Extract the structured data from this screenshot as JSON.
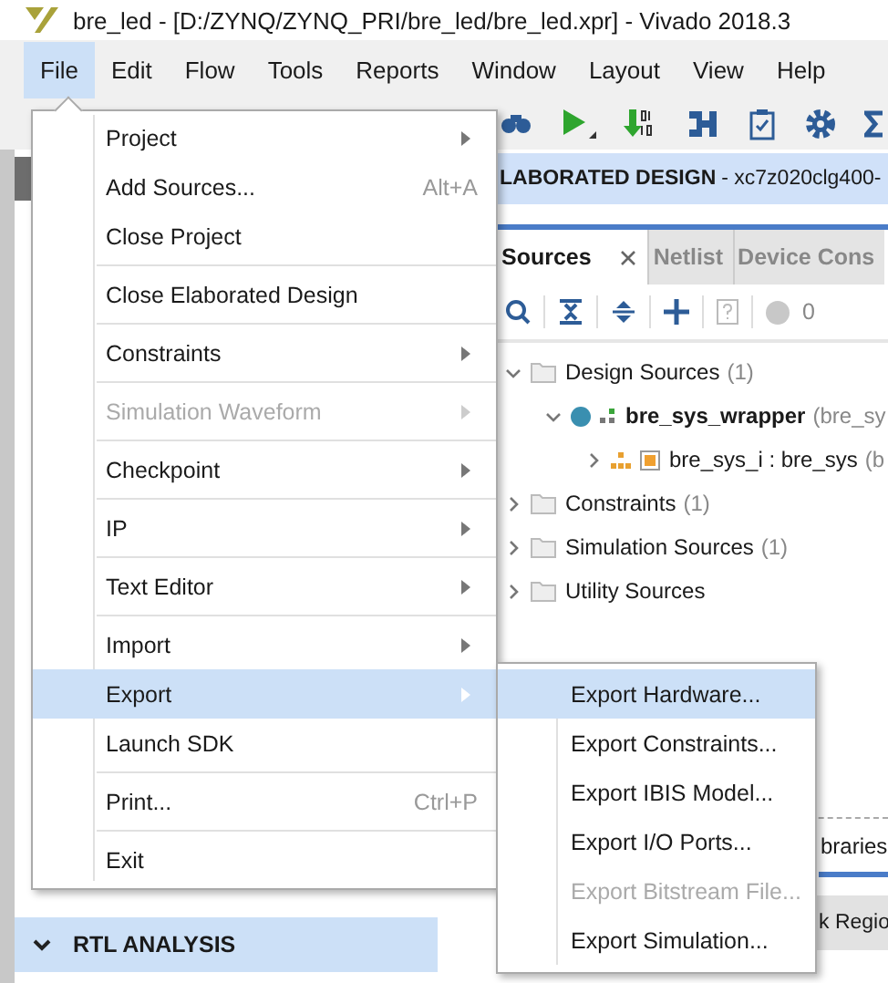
{
  "window": {
    "title": "bre_led - [D:/ZYNQ/ZYNQ_PRI/bre_led/bre_led.xpr] - Vivado 2018.3"
  },
  "menubar": [
    {
      "label": "File",
      "selected": true
    },
    {
      "label": "Edit",
      "selected": false
    },
    {
      "label": "Flow",
      "selected": false
    },
    {
      "label": "Tools",
      "selected": false
    },
    {
      "label": "Reports",
      "selected": false
    },
    {
      "label": "Window",
      "selected": false
    },
    {
      "label": "Layout",
      "selected": false
    },
    {
      "label": "View",
      "selected": false
    },
    {
      "label": "Help",
      "selected": false
    }
  ],
  "file_menu": [
    {
      "kind": "item",
      "label": "Project",
      "submenu": true,
      "disabled": false,
      "selected": false
    },
    {
      "kind": "item",
      "label": "Add Sources...",
      "shortcut": "Alt+A",
      "submenu": false,
      "disabled": false,
      "selected": false
    },
    {
      "kind": "item",
      "label": "Close Project",
      "submenu": false,
      "disabled": false,
      "selected": false
    },
    {
      "kind": "separator"
    },
    {
      "kind": "item",
      "label": "Close Elaborated Design",
      "submenu": false,
      "disabled": false,
      "selected": false
    },
    {
      "kind": "separator"
    },
    {
      "kind": "item",
      "label": "Constraints",
      "submenu": true,
      "disabled": false,
      "selected": false
    },
    {
      "kind": "separator"
    },
    {
      "kind": "item",
      "label": "Simulation Waveform",
      "submenu": true,
      "disabled": true,
      "selected": false
    },
    {
      "kind": "separator"
    },
    {
      "kind": "item",
      "label": "Checkpoint",
      "submenu": true,
      "disabled": false,
      "selected": false
    },
    {
      "kind": "separator"
    },
    {
      "kind": "item",
      "label": "IP",
      "submenu": true,
      "disabled": false,
      "selected": false
    },
    {
      "kind": "separator"
    },
    {
      "kind": "item",
      "label": "Text Editor",
      "submenu": true,
      "disabled": false,
      "selected": false
    },
    {
      "kind": "separator"
    },
    {
      "kind": "item",
      "label": "Import",
      "submenu": true,
      "disabled": false,
      "selected": false
    },
    {
      "kind": "item",
      "label": "Export",
      "submenu": true,
      "disabled": false,
      "selected": true
    },
    {
      "kind": "item",
      "label": "Launch SDK",
      "submenu": false,
      "disabled": false,
      "selected": false
    },
    {
      "kind": "separator"
    },
    {
      "kind": "item",
      "label": "Print...",
      "shortcut": "Ctrl+P",
      "submenu": false,
      "disabled": false,
      "selected": false
    },
    {
      "kind": "separator"
    },
    {
      "kind": "item",
      "label": "Exit",
      "submenu": false,
      "disabled": false,
      "selected": false
    }
  ],
  "export_submenu": [
    {
      "label": "Export Hardware...",
      "disabled": false,
      "selected": true
    },
    {
      "label": "Export Constraints...",
      "disabled": false,
      "selected": false
    },
    {
      "label": "Export IBIS Model...",
      "disabled": false,
      "selected": false
    },
    {
      "label": "Export I/O Ports...",
      "disabled": false,
      "selected": false
    },
    {
      "label": "Export Bitstream File...",
      "disabled": true,
      "selected": false
    },
    {
      "label": "Export Simulation...",
      "disabled": false,
      "selected": false
    }
  ],
  "flow_navigator": {
    "section": "RTL ANALYSIS",
    "expanded": true
  },
  "design_header": {
    "title": "LABORATED DESIGN",
    "part": "- xc7z020clg400-"
  },
  "sources_tabs": [
    {
      "label": "Sources",
      "selected": true
    },
    {
      "label": "Netlist",
      "selected": false
    },
    {
      "label": "Device Cons",
      "selected": false
    }
  ],
  "sources_toolbar": {
    "count": "0"
  },
  "source_tree": [
    {
      "kind": "folder",
      "label": "Design Sources",
      "count": "(1)",
      "expanded": true,
      "children": [
        {
          "kind": "top_module",
          "label": "bre_sys_wrapper",
          "detail": "(bre_sy",
          "expanded": true,
          "children": [
            {
              "kind": "block_design",
              "label": "bre_sys_i : bre_sys",
              "detail": "(b",
              "expanded": false
            }
          ]
        }
      ]
    },
    {
      "kind": "folder",
      "label": "Constraints",
      "count": "(1)",
      "expanded": false
    },
    {
      "kind": "folder",
      "label": "Simulation Sources",
      "count": "(1)",
      "expanded": false
    },
    {
      "kind": "folder",
      "label": "Utility Sources",
      "expanded": false
    }
  ],
  "bottom_panel": {
    "tabs": [
      {
        "label": "braries",
        "selected": true
      }
    ],
    "row": "k Regio"
  }
}
